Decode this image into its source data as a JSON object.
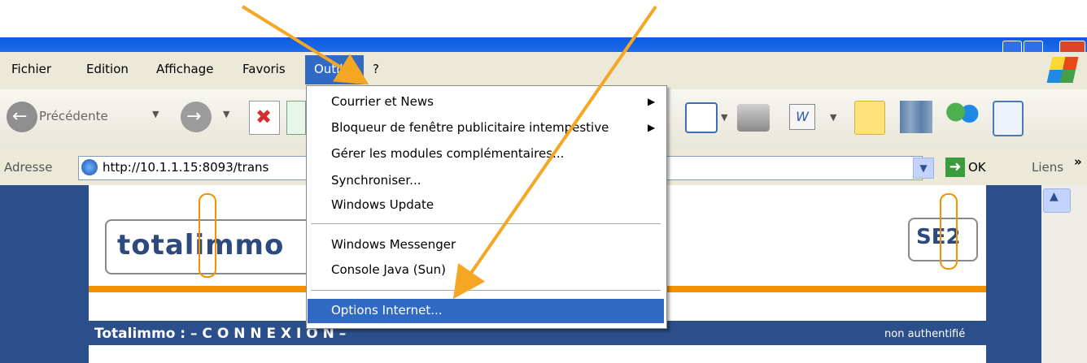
{
  "menubar": {
    "items": [
      "Fichier",
      "Edition",
      "Affichage",
      "Favoris",
      "Outils",
      "?"
    ]
  },
  "toolbar": {
    "back_label": "Précédente"
  },
  "address": {
    "label": "Adresse",
    "url": "http://10.1.1.15:8093/trans",
    "go_label": "OK",
    "links_label": "Liens",
    "more": "»"
  },
  "dropdown": {
    "items": [
      "Courrier et News",
      "Bloqueur de fenêtre publicitaire intempestive",
      "Gérer les modules complémentaires...",
      "Synchroniser...",
      "Windows Update",
      "Windows Messenger",
      "Console Java (Sun)",
      "Options Internet..."
    ]
  },
  "page": {
    "logo_left": "totalimmo",
    "logo_right": "SE2",
    "bar_title": "Totalimmo : – C O N N E X I O N –",
    "status": "non authentifié"
  },
  "colors": {
    "accent": "#316ac5",
    "orange": "#f39200",
    "arrow": "#f5a623",
    "navy": "#2b4f8b"
  }
}
